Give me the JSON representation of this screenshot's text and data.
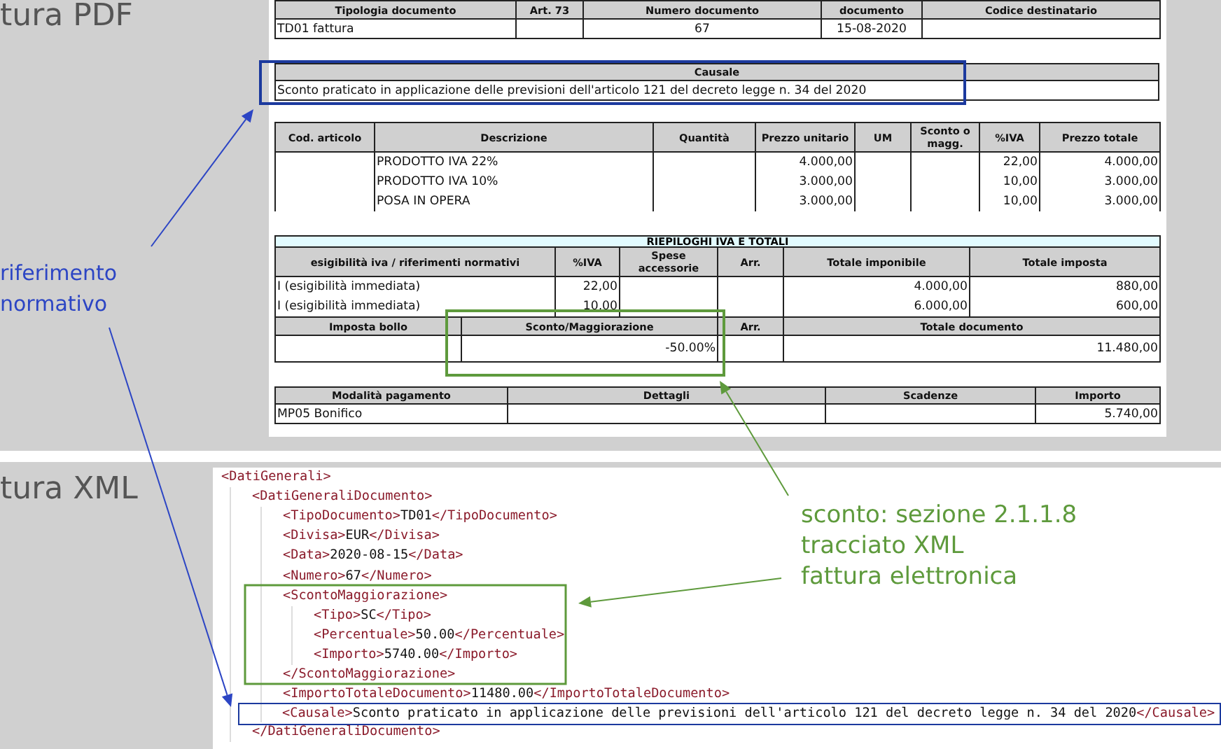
{
  "sections": {
    "pdf_title": "tura PDF",
    "xml_title": "tura XML"
  },
  "notes": [
    {
      "lines": [
        "riferimento",
        "normativo"
      ],
      "color": "#2c45c4"
    },
    {
      "lines": [
        "sconto: sezione 2.1.1.8",
        "tracciato XML",
        "fattura elettronica"
      ],
      "color": "#5e9a3c"
    }
  ],
  "document": {
    "header_table": {
      "columns": [
        "Tipologia documento",
        "Art. 73",
        "Numero documento",
        "documento",
        "Codice destinatario"
      ],
      "rows": [
        [
          "TD01 fattura",
          null,
          "67",
          "15-08-2020",
          null
        ]
      ]
    },
    "causale": {
      "heading": "Causale",
      "text": "Sconto praticato in applicazione delle previsioni dell'articolo 121 del decreto legge n. 34 del 2020"
    },
    "lines_table": {
      "columns": [
        "Cod. articolo",
        "Descrizione",
        "Quantità",
        "Prezzo unitario",
        "UM",
        "Sconto o magg.",
        "%IVA",
        "Prezzo totale"
      ],
      "rows": [
        [
          null,
          "PRODOTTO IVA 22%",
          null,
          "4.000,00",
          null,
          null,
          "22,00",
          "4.000,00"
        ],
        [
          null,
          "PRODOTTO IVA 10%",
          null,
          "3.000,00",
          null,
          null,
          "10,00",
          "3.000,00"
        ],
        [
          null,
          "POSA IN OPERA",
          null,
          "3.000,00",
          null,
          null,
          "10,00",
          "3.000,00"
        ]
      ]
    },
    "summary": {
      "title": "RIEPILOGHI IVA E TOTALI",
      "columns": [
        "esigibilità iva / riferimenti normativi",
        "%IVA",
        "Spese accessorie",
        "Arr.",
        "Totale imponibile",
        "Totale imposta"
      ],
      "rows": [
        [
          "I (esigibilità immediata)",
          "22,00",
          null,
          null,
          "4.000,00",
          "880,00"
        ],
        [
          "I (esigibilità immediata)",
          "10,00",
          null,
          null,
          "6.000,00",
          "600,00"
        ]
      ],
      "totals_columns": [
        "Imposta bollo",
        "Sconto/Maggiorazione",
        "Arr.",
        "Totale documento"
      ],
      "totals_row": {
        "sconto_maggiorazione": "-50.00%",
        "totale_documento": "11.480,00"
      }
    },
    "payment_table": {
      "columns": [
        "Modalità pagamento",
        "Dettagli",
        "Scadenze",
        "Importo"
      ],
      "rows": [
        [
          "MP05 Bonifico",
          null,
          null,
          "5.740,00"
        ]
      ]
    }
  },
  "xml": [
    {
      "open": "<DatiGenerali>",
      "children": [
        {
          "open": "<DatiGeneraliDocumento>",
          "close": "</DatiGeneraliDocumento>",
          "children": [
            {
              "open": "<TipoDocumento>TD01</TipoDocumento>"
            },
            {
              "open": "<Divisa>EUR</Divisa>"
            },
            {
              "open": "<Data>2020-08-15</Data>"
            },
            {
              "open": "<Numero>67</Numero>"
            },
            {
              "open": "<ScontoMaggiorazione>",
              "close": "</ScontoMaggiorazione>",
              "children": [
                {
                  "open": "<Tipo>SC</Tipo>"
                },
                {
                  "open": "<Percentuale>50.00</Percentuale>"
                },
                {
                  "open": "<Importo>5740.00</Importo>"
                }
              ]
            },
            {
              "open": "<ImportoTotaleDocumento>11480.00</ImportoTotaleDocumento>"
            },
            {
              "highlighted": true,
              "open": "<Causale>Sconto praticato in applicazione delle previsioni dell'articolo 121 del decreto legge n. 34 del 2020</Causale>"
            }
          ]
        }
      ]
    }
  ]
}
